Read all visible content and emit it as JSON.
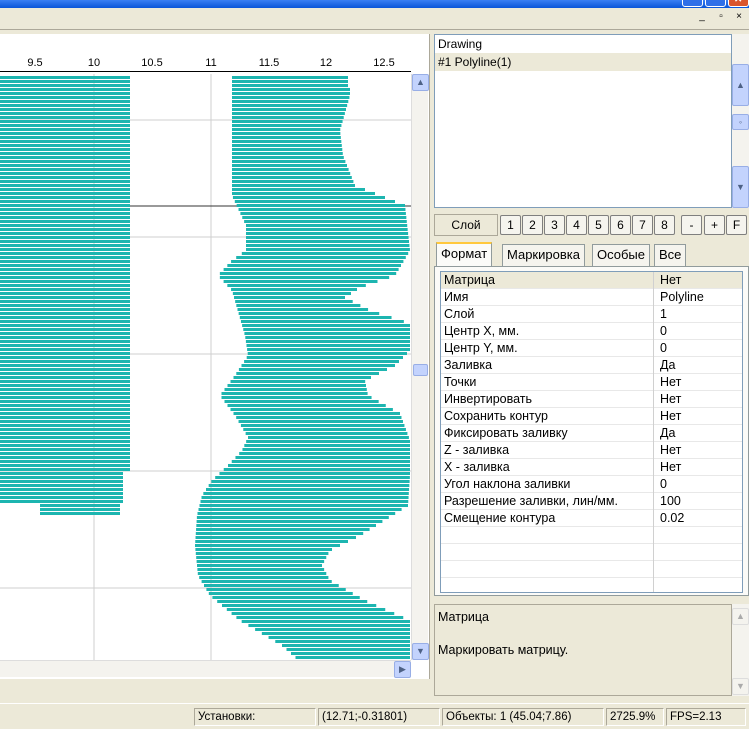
{
  "window": {
    "mdi_min": "_",
    "mdi_restore": "▫",
    "mdi_close": "×"
  },
  "ruler": {
    "ticks": [
      "9.5",
      "10",
      "10.5",
      "11",
      "11.5",
      "12",
      "12.5"
    ]
  },
  "object_list": {
    "items": [
      {
        "label": "Drawing"
      },
      {
        "label": "#1 Polyline(1)"
      }
    ]
  },
  "layers": {
    "label": "Слой",
    "buttons": [
      "1",
      "2",
      "3",
      "4",
      "5",
      "6",
      "7",
      "8"
    ],
    "minus": "-",
    "plus": "+",
    "f": "F"
  },
  "tabs": [
    "Формат",
    "Маркировка",
    "Особые",
    "Все"
  ],
  "properties": [
    {
      "name": "Матрица",
      "value": "Нет"
    },
    {
      "name": "Имя",
      "value": "Polyline"
    },
    {
      "name": "Слой",
      "value": "1"
    },
    {
      "name": "Центр X, мм.",
      "value": "0"
    },
    {
      "name": "Центр Y, мм.",
      "value": "0"
    },
    {
      "name": "Заливка",
      "value": "Да"
    },
    {
      "name": "Точки",
      "value": "Нет"
    },
    {
      "name": "Инвертировать",
      "value": "Нет"
    },
    {
      "name": "Сохранить контур",
      "value": "Нет"
    },
    {
      "name": "Фиксировать заливку",
      "value": "Да"
    },
    {
      "name": "Z - заливка",
      "value": "Нет"
    },
    {
      "name": "X - заливка",
      "value": "Нет"
    },
    {
      "name": "Угол наклона заливки",
      "value": "0"
    },
    {
      "name": "Разрешение заливки, лин/мм.",
      "value": "100"
    },
    {
      "name": "Смещение контура",
      "value": "0.02"
    }
  ],
  "description": {
    "title": "Матрица",
    "text": "Маркировать матрицу."
  },
  "status": {
    "settings": "Установки:",
    "coords": "(12.71;-0.31801)",
    "objects": "Объекты: 1 (45.04;7.86)",
    "zoom": "2725.9%",
    "fps": "FPS=2.13"
  },
  "colors": {
    "fill": "#1db5b0",
    "grid": "#cfcfcf"
  }
}
